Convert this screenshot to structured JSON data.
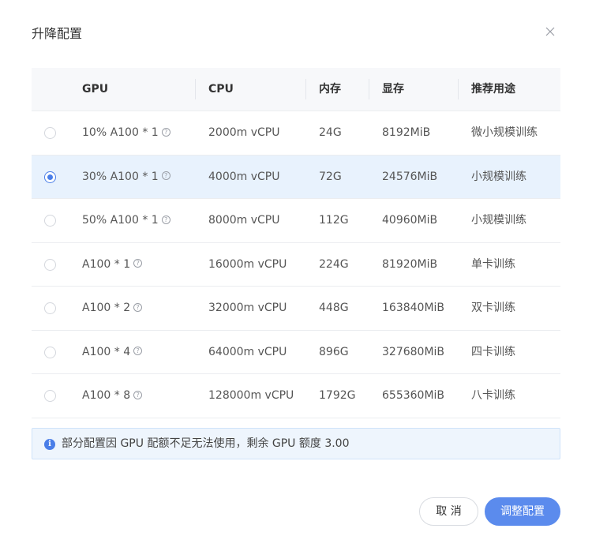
{
  "dialog": {
    "title": "升降配置",
    "close_icon": "close-icon"
  },
  "table": {
    "headers": {
      "gpu": "GPU",
      "cpu": "CPU",
      "memory": "内存",
      "vram": "显存",
      "usage": "推荐用途"
    },
    "rows": [
      {
        "gpu": "10% A100 * 1",
        "cpu": "2000m vCPU",
        "memory": "24G",
        "vram": "8192MiB",
        "usage": "微小规模训练",
        "selected": false
      },
      {
        "gpu": "30% A100 * 1",
        "cpu": "4000m vCPU",
        "memory": "72G",
        "vram": "24576MiB",
        "usage": "小规模训练",
        "selected": true
      },
      {
        "gpu": "50% A100 * 1",
        "cpu": "8000m vCPU",
        "memory": "112G",
        "vram": "40960MiB",
        "usage": "小规模训练",
        "selected": false
      },
      {
        "gpu": "A100 * 1",
        "cpu": "16000m vCPU",
        "memory": "224G",
        "vram": "81920MiB",
        "usage": "单卡训练",
        "selected": false
      },
      {
        "gpu": "A100 * 2",
        "cpu": "32000m vCPU",
        "memory": "448G",
        "vram": "163840MiB",
        "usage": "双卡训练",
        "selected": false
      },
      {
        "gpu": "A100 * 4",
        "cpu": "64000m vCPU",
        "memory": "896G",
        "vram": "327680MiB",
        "usage": "四卡训练",
        "selected": false
      },
      {
        "gpu": "A100 * 8",
        "cpu": "128000m vCPU",
        "memory": "1792G",
        "vram": "655360MiB",
        "usage": "八卡训练",
        "selected": false
      }
    ],
    "help_glyph": "?"
  },
  "notice": {
    "icon_glyph": "i",
    "text": "部分配置因 GPU 配额不足无法使用，剩余 GPU 额度 3.00"
  },
  "footer": {
    "cancel_label": "取 消",
    "confirm_label": "调整配置"
  },
  "colors": {
    "accent": "#5b8bed",
    "selected_row": "#e8f2fd",
    "notice_bg": "#eef5fd"
  }
}
